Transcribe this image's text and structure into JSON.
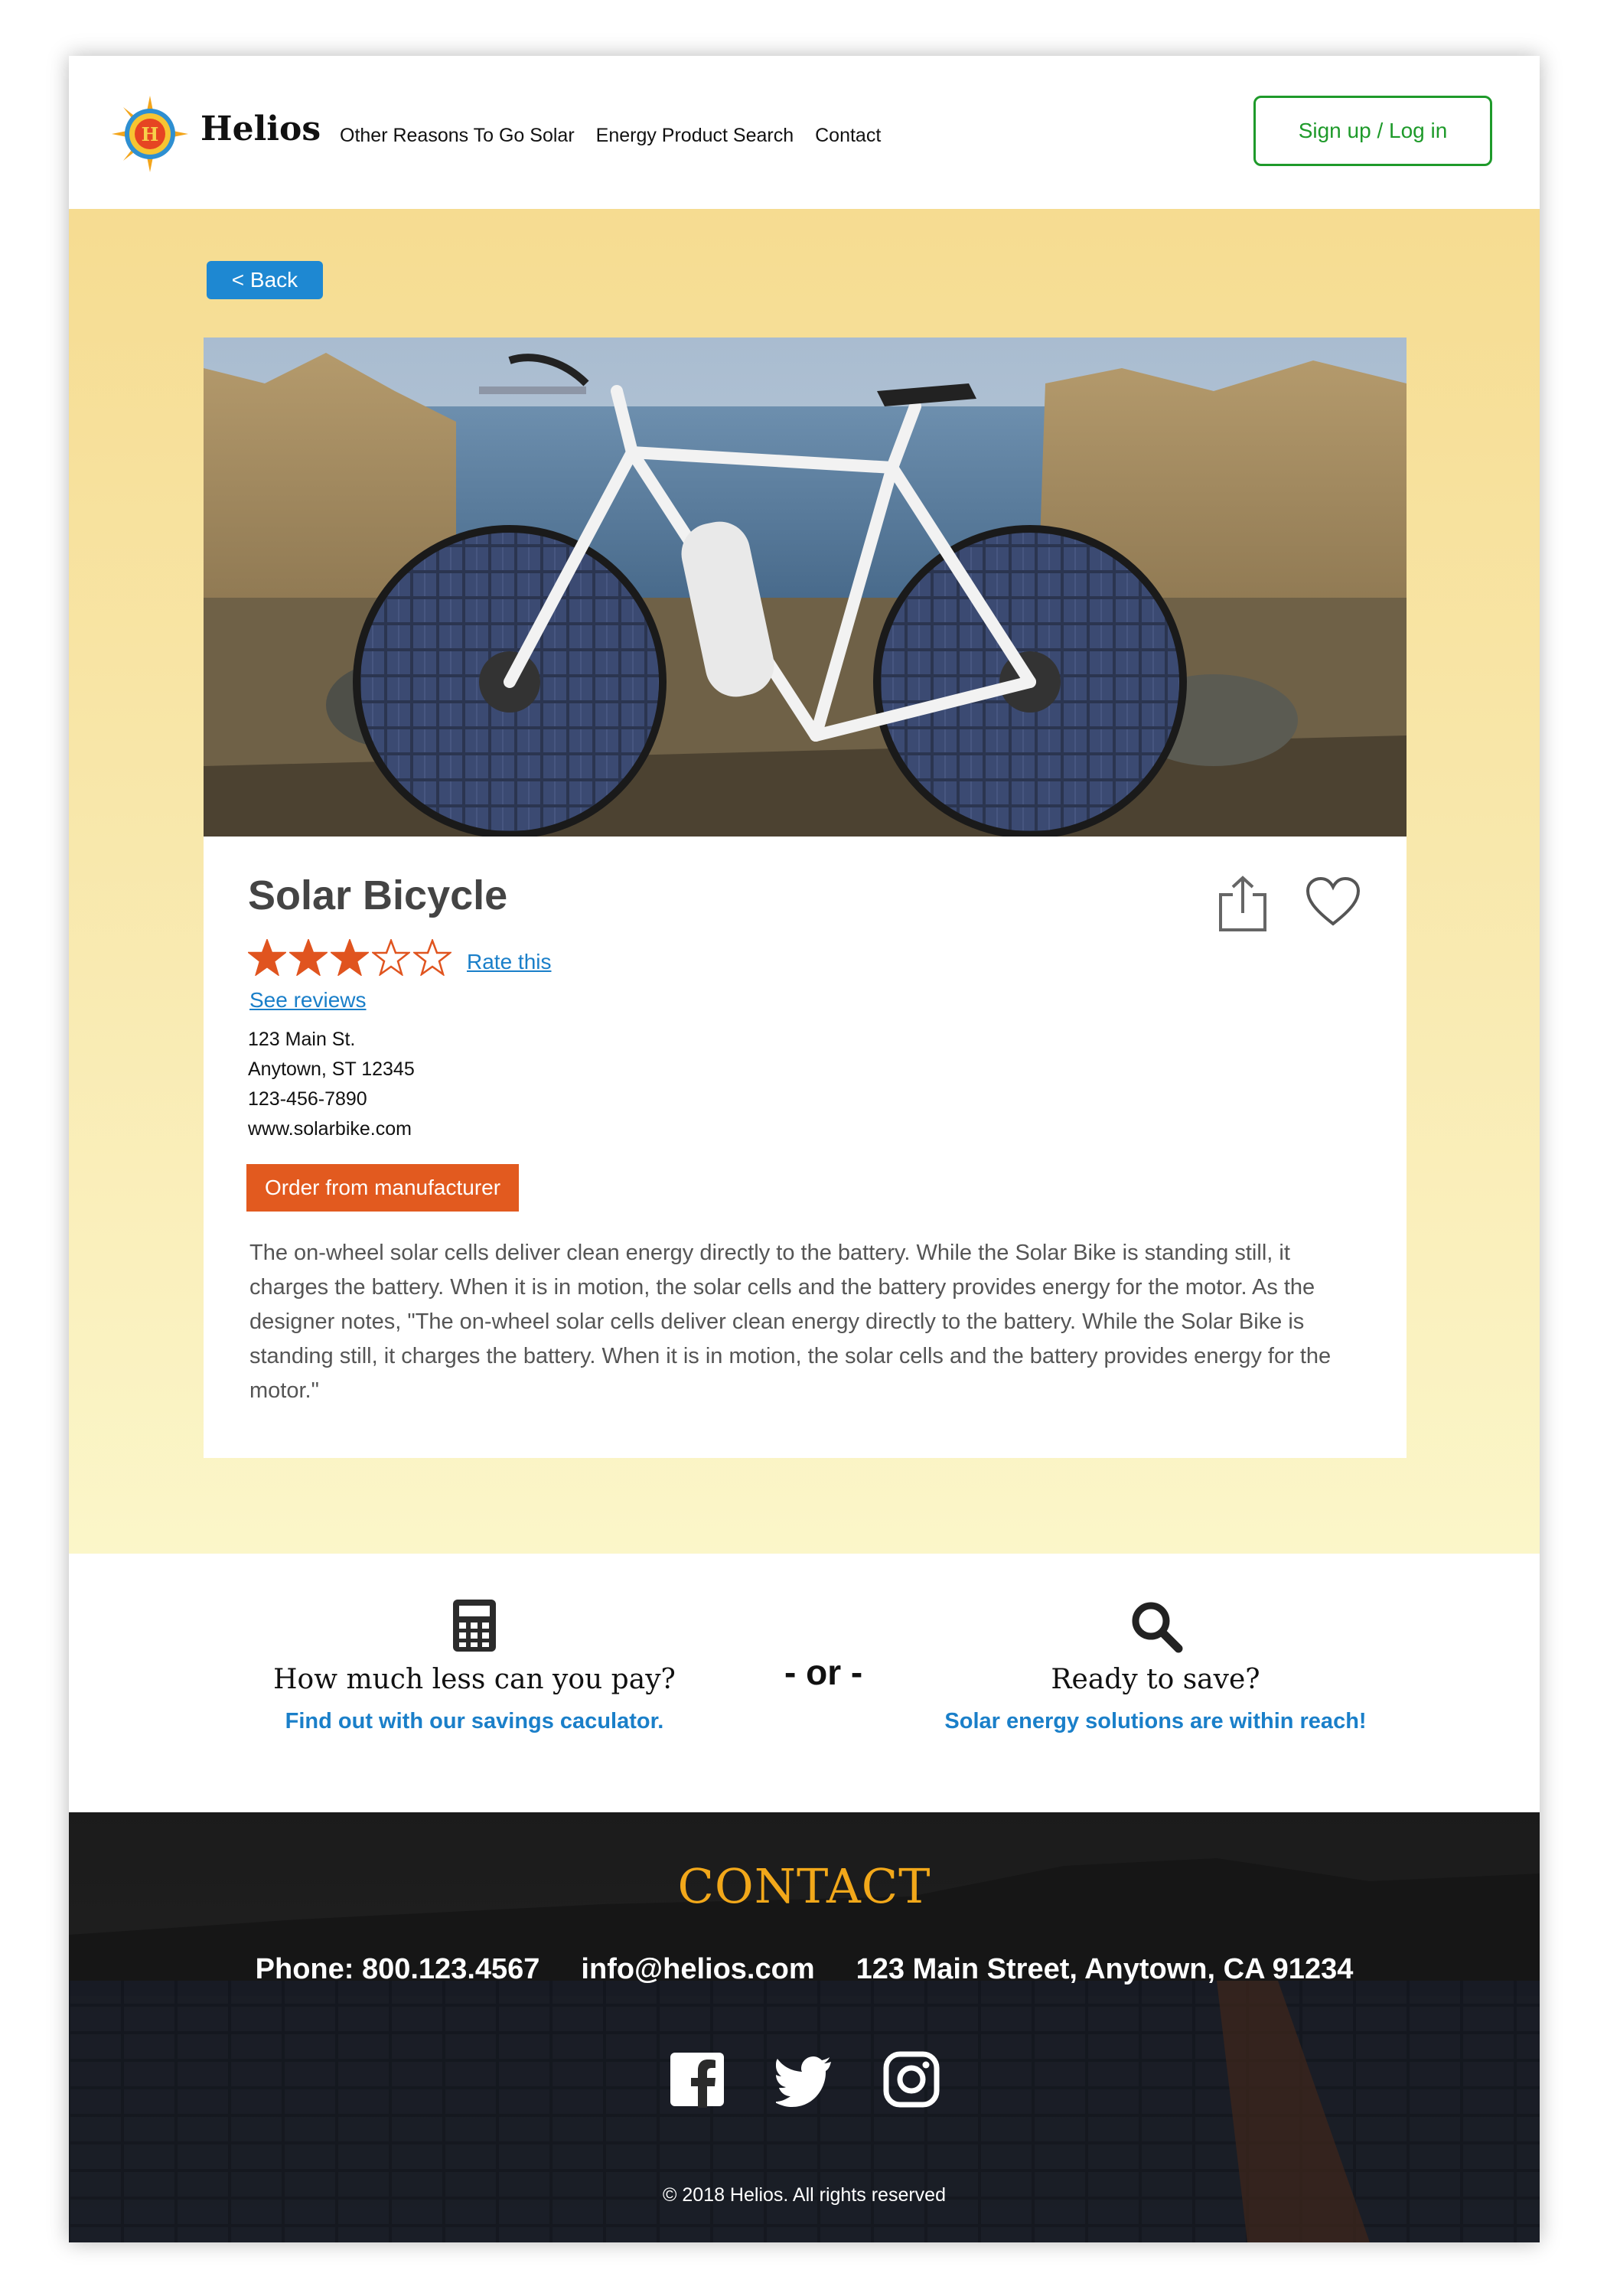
{
  "header": {
    "brand": "Helios",
    "nav": [
      "Other Reasons To Go Solar",
      "Energy Product Search",
      "Contact"
    ],
    "signup_label": "Sign up / Log in"
  },
  "product": {
    "back_label": "< Back",
    "title": "Solar Bicycle",
    "rating": 3,
    "rating_max": 5,
    "rate_label": "Rate this",
    "reviews_label": "See reviews",
    "address_lines": [
      "123 Main St.",
      "Anytown, ST 12345",
      "123-456-7890",
      "www.solarbike.com"
    ],
    "order_label": "Order from manufacturer",
    "description": "The on-wheel solar cells deliver clean energy directly to the battery. While the Solar Bike is standing still, it charges the battery. When it is in motion, the solar cells and the battery provides energy for the motor. As the designer notes, \"The on-wheel solar cells deliver clean energy directly to the battery. While the Solar Bike is standing still, it charges the battery. When it is in motion, the solar cells and the battery provides energy for the motor.\""
  },
  "cta": {
    "left_question": "How much less can you pay?",
    "left_link": "Find out with our savings caculator.",
    "or_label": "- or -",
    "right_question": "Ready to save?",
    "right_link": "Solar energy solutions are within reach!"
  },
  "footer": {
    "heading": "CONTACT",
    "phone": "Phone: 800.123.4567",
    "email": "info@helios.com",
    "address": "123 Main Street, Anytown, CA 91234",
    "copyright": "© 2018 Helios. All rights reserved"
  },
  "colors": {
    "accent_green": "#1e9a2a",
    "link_blue": "#1a7fc9",
    "order_orange": "#e25a1f",
    "star_orange": "#e0541f",
    "contact_gold": "#f2a81a"
  },
  "icons": [
    "helios-logo-icon",
    "share-icon",
    "heart-icon",
    "calculator-icon",
    "search-icon",
    "facebook-icon",
    "twitter-icon",
    "instagram-icon"
  ]
}
